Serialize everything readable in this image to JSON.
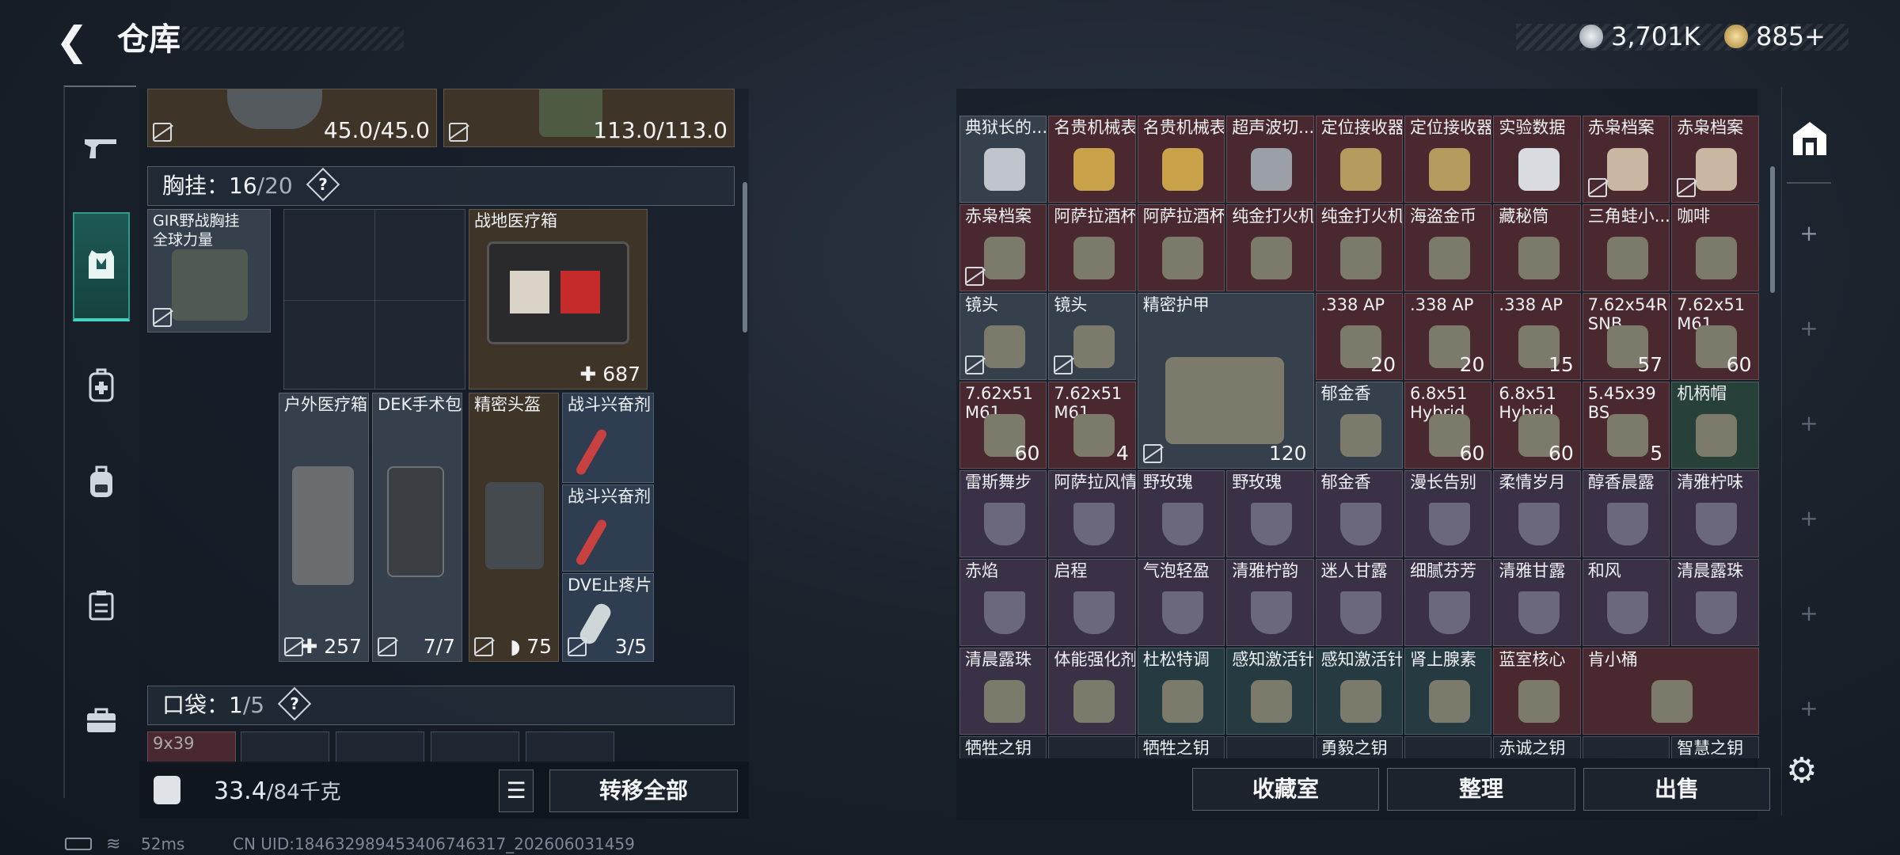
{
  "header": {
    "title": "仓库",
    "back_glyph": "<"
  },
  "currency": [
    {
      "value": "3,701K",
      "icon": "silver-coin-icon",
      "color": "#c9ced6"
    },
    {
      "value": "885+",
      "icon": "gold-coin-icon",
      "color": "#d9b45a"
    }
  ],
  "sidebar": {
    "items": [
      "gun-icon",
      "vest-icon",
      "backpack-medic-icon",
      "backpack-icon",
      "case-icon",
      "toolbox-icon"
    ]
  },
  "left": {
    "top_items": [
      {
        "value": "45.0/45.0"
      },
      {
        "value": "113.0/113.0"
      }
    ],
    "chest_rig": {
      "label": "胸挂：",
      "used": "16",
      "total": "/20",
      "help": "?"
    },
    "rig_item": {
      "label": "GIR野战胸挂\n全球力量"
    },
    "items": [
      {
        "label": "战地医疗箱",
        "num": "687",
        "mark": "plus-icon"
      },
      {
        "label": "户外医疗箱",
        "num": "257",
        "mark": "plus-icon"
      },
      {
        "label": "DEK手术包",
        "num": "7/7"
      },
      {
        "label": "精密头盔",
        "num": "75",
        "mark": "shield-icon"
      },
      {
        "label": "战斗兴奋剂",
        "num": ""
      },
      {
        "label": "战斗兴奋剂",
        "num": ""
      },
      {
        "label": "DVE止疼片",
        "num": "3/5"
      }
    ],
    "pocket": {
      "label": "口袋：",
      "used": "1",
      "total": "/5",
      "help": "?"
    },
    "pocket_peek": "9x39",
    "weight": {
      "current": "33.4",
      "max": "/84千克"
    },
    "transfer_all": "转移全部"
  },
  "right": {
    "rows": [
      [
        "典狱长的...",
        "名贵机械表",
        "名贵机械表",
        "超声波切...",
        "定位接收器",
        "定位接收器",
        "实验数据",
        "赤枭档案",
        "赤枭档案"
      ],
      [
        "赤枭档案",
        "阿萨拉酒杯",
        "阿萨拉酒杯",
        "纯金打火机",
        "纯金打火机",
        "海盗金币",
        "藏秘筒",
        "三角蛙小...",
        "咖啡"
      ],
      [
        "镜头",
        "镜头",
        "精密护甲",
        ".338 AP",
        ".338 AP",
        ".338 AP",
        "7.62x54R SNB",
        "7.62x51 M61"
      ],
      [
        "7.62x51 M61",
        "7.62x51 M61",
        "郁金香",
        "6.8x51 Hybrid",
        "6.8x51 Hybrid",
        "5.45x39 BS",
        "机柄帽"
      ],
      [
        "雷斯舞步",
        "阿萨拉风情",
        "野玫瑰",
        "野玫瑰",
        "郁金香",
        "漫长告别",
        "柔情岁月",
        "醇香晨露",
        "清雅柠味"
      ],
      [
        "赤焰",
        "启程",
        "气泡轻盈",
        "清雅柠韵",
        "迷人甘露",
        "细腻芬芳",
        "清雅甘露",
        "和风",
        "清晨露珠"
      ],
      [
        "清晨露珠",
        "体能强化剂",
        "杜松特调",
        "感知激活针",
        "感知激活针",
        "肾上腺素",
        "蓝室核心",
        "肯小桶"
      ],
      [
        "牺牲之钥",
        "",
        "牺牲之钥",
        "",
        "勇毅之钥",
        "",
        "赤诚之钥",
        "",
        "智慧之钥"
      ]
    ],
    "counts": {
      "r2_c3": "20",
      "r2_c4": "20",
      "r2_c5": "15",
      "r2_c6": "57",
      "r2_c7": "60",
      "r3_c0": "60",
      "r3_c1": "4",
      "r3_c3": "60",
      "r3_c4": "60",
      "r3_c5": "5",
      "armor": "120"
    },
    "buttons": [
      "收藏室",
      "整理",
      "出售"
    ]
  },
  "status": {
    "ping": "52ms",
    "uid": "CN UID:18463298945340674631​7_202606031459"
  }
}
